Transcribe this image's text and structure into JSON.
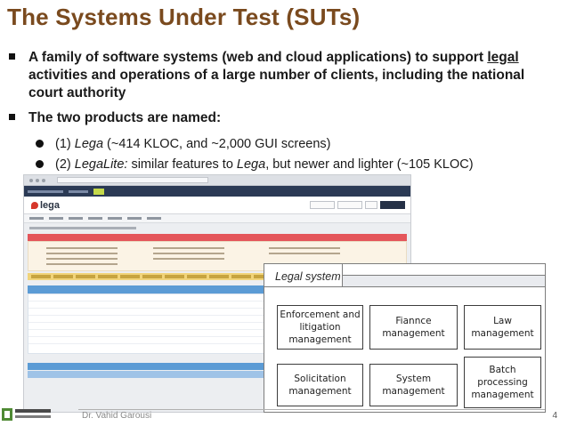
{
  "slide": {
    "title": "The Systems Under Test (SUTs)",
    "bullet1": {
      "pre": "A family of software systems (web and cloud applications) to support ",
      "underlined": "legal",
      "post": " activities and operations of a large number of clients, including the national court authority"
    },
    "bullet2": "The two products are named:",
    "sub1": {
      "num": "(1) ",
      "name": "Lega",
      "rest": " (~414 KLOC, and ~2,000 GUI screens)"
    },
    "sub2": {
      "num": "(2) ",
      "name": "LegaLite:",
      "mid": " similar features to ",
      "name2": "Lega",
      "rest": ", but newer and lighter (~105 KLOC)"
    }
  },
  "screenshot": {
    "logo_text": "lega"
  },
  "diagram": {
    "label": "Legal system",
    "boxes": [
      "Enforcement and litigation management",
      "Fiannce management",
      "Law management",
      "Solicitation management",
      "System management",
      "Batch processing management"
    ]
  },
  "footer": {
    "author": "Dr. Vahid Garousi",
    "page": "4"
  }
}
